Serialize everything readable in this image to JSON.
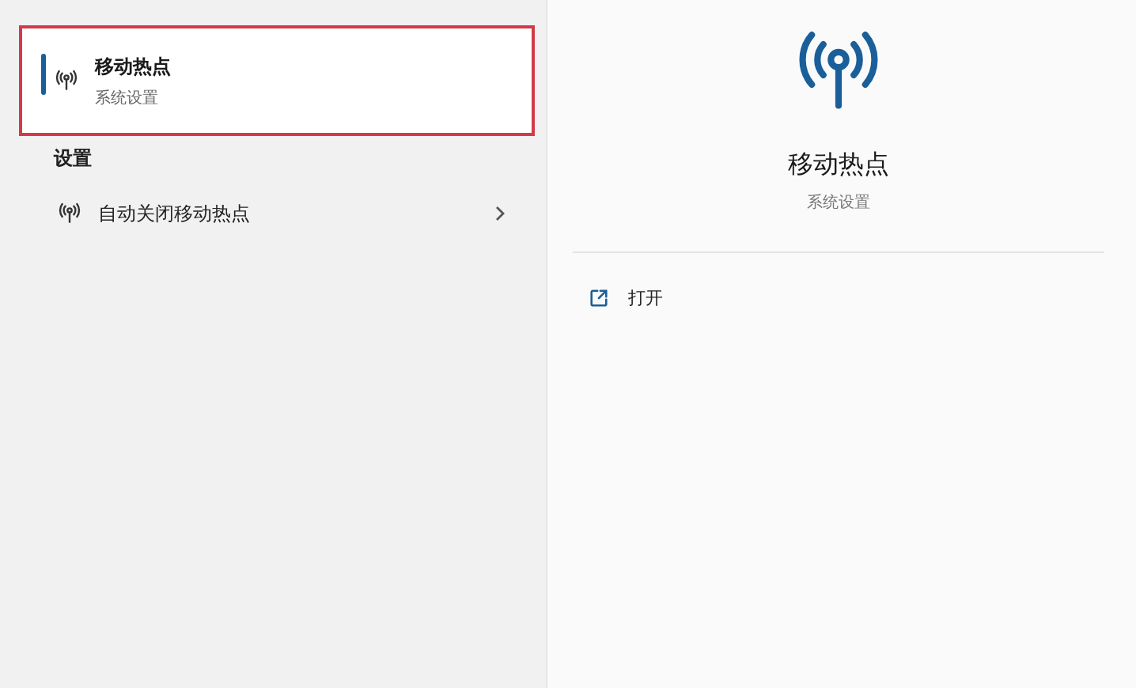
{
  "results": {
    "best_match": {
      "title": "移动热点",
      "subtitle": "系统设置",
      "selected": true,
      "highlighted": true
    },
    "settings_heading": "设置",
    "settings_items": [
      {
        "label": "自动关闭移动热点"
      }
    ]
  },
  "preview": {
    "title": "移动热点",
    "subtitle": "系统设置",
    "actions": [
      {
        "label": "打开"
      }
    ]
  }
}
